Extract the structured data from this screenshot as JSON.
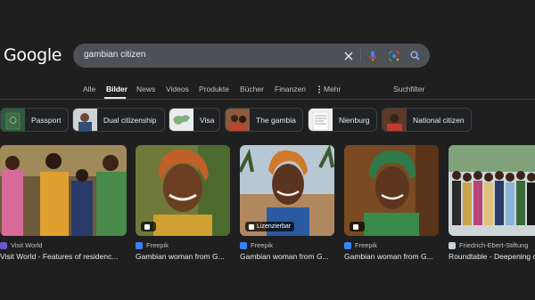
{
  "logo": "Google",
  "search": {
    "query": "gambian citizen"
  },
  "tabs": [
    {
      "label": "Alle"
    },
    {
      "label": "Bilder"
    },
    {
      "label": "News"
    },
    {
      "label": "Videos"
    },
    {
      "label": "Produkte"
    },
    {
      "label": "Bücher"
    },
    {
      "label": "Finanzen"
    },
    {
      "label": "Mehr"
    }
  ],
  "suchfilter": "Suchfilter",
  "chips": [
    {
      "label": "Passport"
    },
    {
      "label": "Dual citizenship"
    },
    {
      "label": "Visa"
    },
    {
      "label": "The gambia"
    },
    {
      "label": "Nienburg"
    },
    {
      "label": "National citizen"
    }
  ],
  "results": [
    {
      "source": "Visit World",
      "title": "Visit World - Features of residenc...",
      "badge": ""
    },
    {
      "source": "Freepik",
      "title": "Gambian woman from G...",
      "badge": ""
    },
    {
      "source": "Freepik",
      "title": "Gambian woman from G...",
      "badge": "Lizenzierbar"
    },
    {
      "source": "Freepik",
      "title": "Gambian woman from G...",
      "badge": ""
    },
    {
      "source": "Friedrich-Ebert-Stiftung",
      "title": "Roundtable - Deepening c...",
      "badge": ""
    }
  ],
  "colors": {
    "background": "#1f1f1f",
    "searchbox": "#4d5156",
    "mic": "#4285f4",
    "lens": "#34a853",
    "search_icon": "#8ab4f8"
  }
}
